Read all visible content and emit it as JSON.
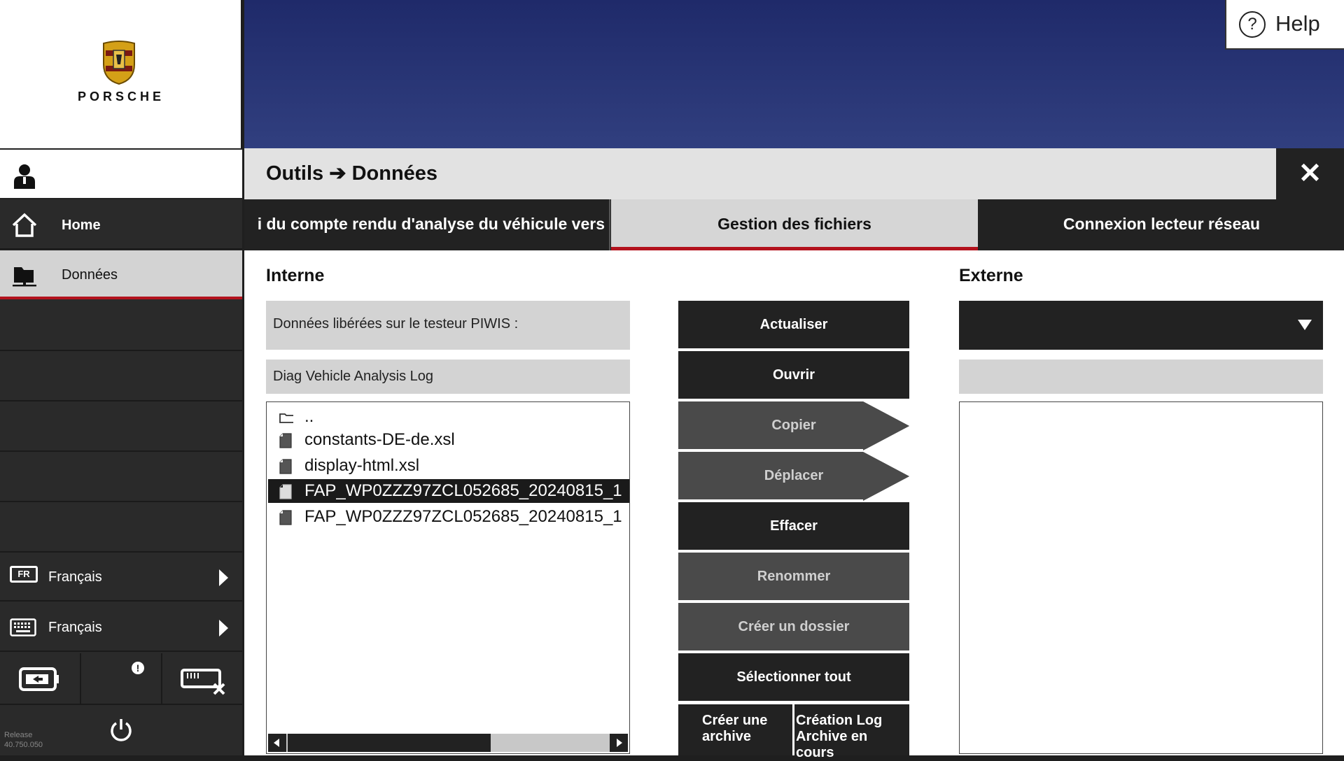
{
  "brand": {
    "logo_text": "PORSCHE"
  },
  "sidebar": {
    "items": [
      {
        "label": "Home",
        "icon": "home-icon"
      },
      {
        "label": "Données",
        "icon": "folder-icon"
      }
    ],
    "language_ui": {
      "badge": "FR",
      "label": "Français"
    },
    "language_keyboard": {
      "label": "Français"
    },
    "release": {
      "label": "Release",
      "version": "40.750.050"
    }
  },
  "help": {
    "icon_glyph": "?",
    "label": "Help"
  },
  "dialog": {
    "title": "Outils ➔ Données",
    "close_glyph": "✕",
    "tabs": [
      {
        "label": "i du compte rendu d'analyse du véhicule vers"
      },
      {
        "label": "Gestion des fichiers",
        "active": true
      },
      {
        "label": "Connexion lecteur réseau"
      }
    ],
    "internal": {
      "title": "Interne",
      "released_label": "Données libérées sur le testeur PIWIS :",
      "path": "Diag Vehicle Analysis Log",
      "files": [
        {
          "name": "..",
          "type": "folder"
        },
        {
          "name": "constants-DE-de.xsl",
          "type": "file"
        },
        {
          "name": "display-html.xsl",
          "type": "file"
        },
        {
          "name": "FAP_WP0ZZZ97ZCL052685_20240815_1",
          "type": "file",
          "selected": true
        },
        {
          "name": "FAP_WP0ZZZ97ZCL052685_20240815_1",
          "type": "file"
        }
      ]
    },
    "actions": {
      "refresh": "Actualiser",
      "open": "Ouvrir",
      "copy": "Copier",
      "move": "Déplacer",
      "delete": "Effacer",
      "rename": "Renommer",
      "create_folder": "Créer un dossier",
      "select_all": "Sélectionner tout",
      "create_archive": "Créer une archive",
      "log_archive": "Création Log Archive en cours"
    },
    "external": {
      "title": "Externe",
      "selected_drive": "",
      "path": ""
    }
  },
  "colors": {
    "accent": "#b3121d",
    "dark": "#222222",
    "panel_grey": "#d3d3d3"
  }
}
